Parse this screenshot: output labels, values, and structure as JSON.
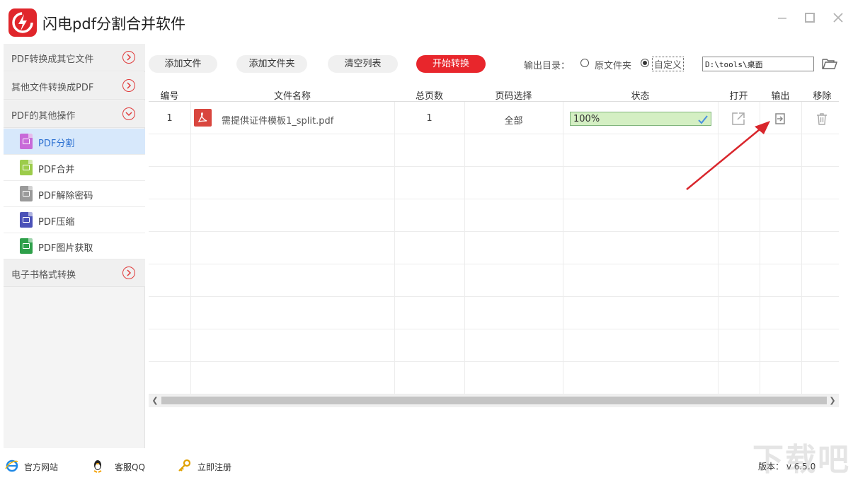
{
  "app": {
    "title": "闪电pdf分割合并软件",
    "window_controls": [
      "minimize",
      "maximize",
      "close"
    ]
  },
  "sidebar": {
    "categories": [
      {
        "label": "PDF转换成其它文件",
        "state": "collapsed"
      },
      {
        "label": "其他文件转换成PDF",
        "state": "collapsed"
      },
      {
        "label": "PDF的其他操作",
        "state": "expanded"
      },
      {
        "label": "电子书格式转换",
        "state": "collapsed"
      }
    ],
    "subitems": [
      {
        "label": "PDF分割",
        "color": "#c86ad8",
        "active": true
      },
      {
        "label": "PDF合并",
        "color": "#9ccc4a",
        "active": false
      },
      {
        "label": "PDF解除密码",
        "color": "#9a9a9a",
        "active": false
      },
      {
        "label": "PDF压缩",
        "color": "#4b52b8",
        "active": false
      },
      {
        "label": "PDF图片获取",
        "color": "#2ea04a",
        "active": false
      }
    ]
  },
  "toolbar": {
    "add_file": "添加文件",
    "add_folder": "添加文件夹",
    "clear_list": "清空列表",
    "start_convert": "开始转换",
    "output_label": "输出目录：",
    "option_original": "原文件夹",
    "option_custom": "自定义",
    "output_path": "D:\\tools\\桌面"
  },
  "table": {
    "headers": [
      "编号",
      "文件名称",
      "总页数",
      "页码选择",
      "状态",
      "打开",
      "输出",
      "移除"
    ],
    "rows": [
      {
        "index": "1",
        "filename": "需提供证件模板1_split.pdf",
        "pages": "1",
        "page_selection": "全部",
        "status": "100%",
        "progress": 1.0
      }
    ]
  },
  "footer": {
    "website": "官方网站",
    "support": "客服QQ",
    "register": "立即注册",
    "version": "版本： v 6.5.0"
  },
  "watermark": "下载吧",
  "colors": {
    "accent_red": "#e8262c",
    "active_blue": "#2a6fd1",
    "progress_green": "#ddf3cf"
  }
}
